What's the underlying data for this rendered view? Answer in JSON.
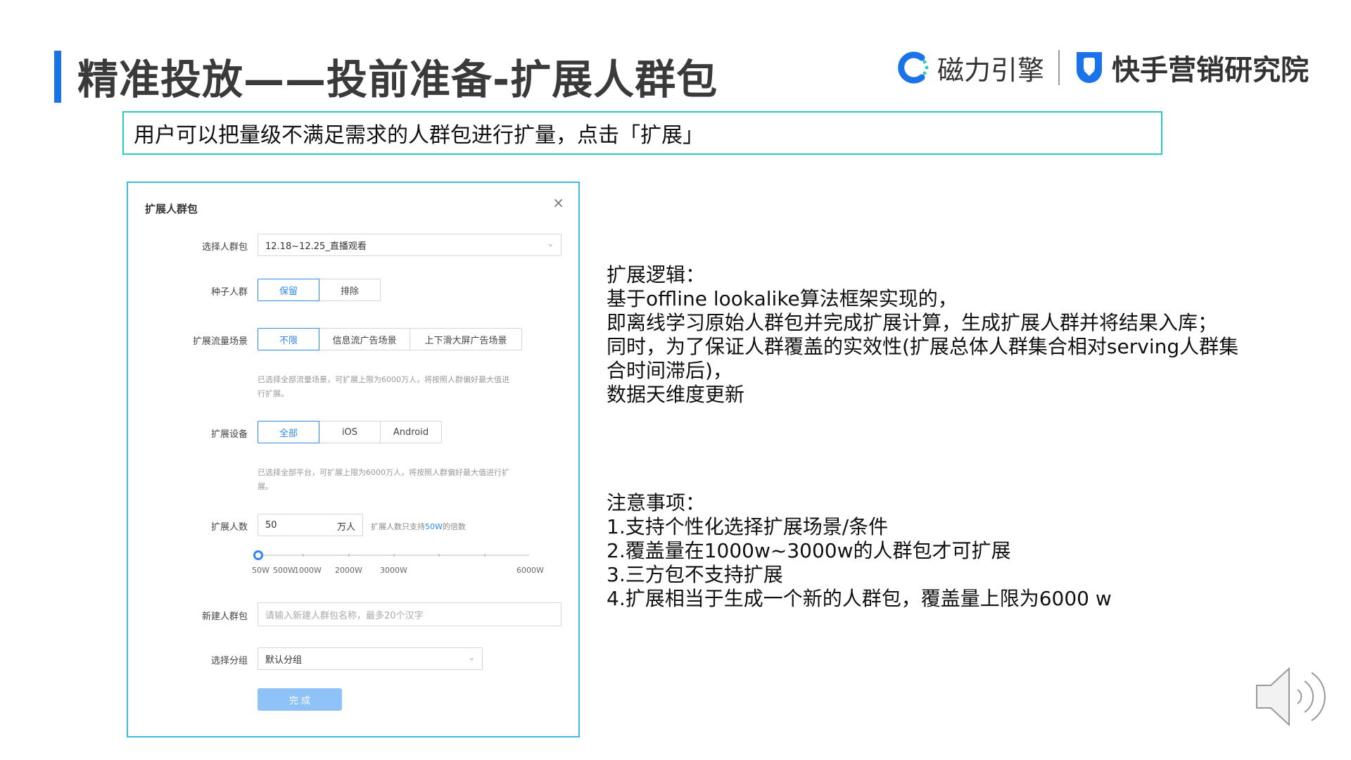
{
  "header": {
    "title": "精准投放——投前准备-扩展人群包",
    "logo1_text": "磁力引擎",
    "logo2_text": "快手营销研究院"
  },
  "subtitle": "用户可以把量级不满足需求的人群包进行扩量，点击「扩展」",
  "modal": {
    "title": "扩展人群包",
    "close": "×",
    "audience": {
      "label": "选择人群包",
      "value": "12.18~12.25_直播观看"
    },
    "seed": {
      "label": "种子人群",
      "options": [
        "保留",
        "排除"
      ],
      "selected": "保留"
    },
    "traffic": {
      "label": "扩展流量场景",
      "options": [
        "不限",
        "信息流广告场景",
        "上下滑大屏广告场景"
      ],
      "selected": "不限",
      "hint_line1": "已选择全部流量场景，可扩展上限为6000万人，将按照人群偏好最大值进",
      "hint_line2": "行扩展。"
    },
    "device": {
      "label": "扩展设备",
      "options": [
        "全部",
        "iOS",
        "Android"
      ],
      "selected": "全部",
      "hint_line1": "已选择全部平台，可扩展上限为6000万人，将按照人群偏好最大值进行扩",
      "hint_line2": "展。"
    },
    "count": {
      "label": "扩展人数",
      "value": "50",
      "unit": "万人",
      "hint_prefix": "扩展人数只支持",
      "hint_highlight": "50W",
      "hint_suffix": "的倍数",
      "slider_labels": [
        "50W",
        "500W",
        "1000W",
        "2000W",
        "3000W",
        "6000W"
      ],
      "slider_value_fraction": 0
    },
    "new_name": {
      "label": "新建人群包",
      "placeholder": "请输入新建人群包名称，最多20个汉字"
    },
    "group": {
      "label": "选择分组",
      "value": "默认分组"
    },
    "done_label": "完 成"
  },
  "logic": {
    "lines": [
      "扩展逻辑：",
      "基于offline lookalike算法框架实现的，",
      "即离线学习原始人群包并完成扩展计算，生成扩展人群并将结果入库；",
      "同时，为了保证人群覆盖的实效性(扩展总体人群集合相对serving人群集",
      "合时间滞后)，",
      "数据天维度更新"
    ]
  },
  "notes": {
    "lines": [
      "注意事项：",
      "1.支持个性化选择扩展场景/条件",
      "2.覆盖量在1000w~3000w的人群包才可扩展",
      "3.三方包不支持扩展",
      "4.扩展相当于生成一个新的人群包，覆盖量上限为6000 w"
    ]
  },
  "colors": {
    "accent": "#2f89ea",
    "title_bar": "#1a73e8",
    "subtitle_border": "#2ac9c0",
    "modal_border": "#3fb8e6"
  },
  "icons": {
    "close": "close-icon",
    "dropdown": "chevron-down-icon",
    "speaker": "speaker-icon"
  }
}
